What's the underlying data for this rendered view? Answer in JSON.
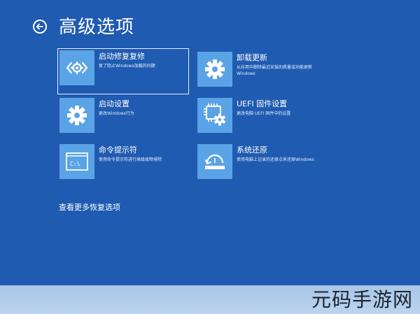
{
  "header": {
    "title": "高级选项",
    "back_icon": "back-arrow-icon"
  },
  "options": [
    {
      "title": "启动修复复修",
      "desc": "复了阻止Windows加载的问题",
      "icon": "code-brackets-gear-icon"
    },
    {
      "title": "卸载更新",
      "desc": "从应用中删除最近安装的质量或功能更新Windows",
      "icon": "gear-icon"
    },
    {
      "title": "启动设置",
      "desc": "更改Windows行为",
      "icon": "gear-icon"
    },
    {
      "title": "UEFI 固件设置",
      "desc": "更改电脑 UEFI 固件中的设置",
      "icon": "chip-gear-icon"
    },
    {
      "title": "命令提示符",
      "desc": "使用命令提示符进行高级故障排除",
      "icon": "command-prompt-icon"
    },
    {
      "title": "系统还原",
      "desc": "使用电脑上记录的还原点来还原Windows",
      "icon": "system-restore-icon"
    }
  ],
  "more_options": "查看更多恢复选项",
  "watermark": "元码手游网",
  "colors": {
    "background": "#1f5bb0",
    "tile": "#5aa3e6",
    "band": "#bcd4ee"
  }
}
